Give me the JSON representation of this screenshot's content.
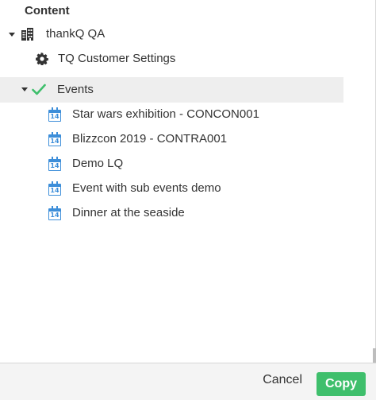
{
  "header": {
    "title": "Content"
  },
  "tree": {
    "root": {
      "label": "thankQ QA",
      "icon": "building-icon",
      "expanded": true
    },
    "settings": {
      "label": "TQ Customer Settings",
      "icon": "gear-icon"
    },
    "events": {
      "label": "Events",
      "icon": "checkmark-icon",
      "expanded": true,
      "selected": true,
      "check_color": "#3fbf6c"
    },
    "event_items": [
      {
        "label": "Star wars exhibition - CONCON001",
        "icon": "calendar-icon",
        "icon_text": "14"
      },
      {
        "label": "Blizzcon 2019 - CONTRA001",
        "icon": "calendar-icon",
        "icon_text": "14"
      },
      {
        "label": "Demo LQ",
        "icon": "calendar-icon",
        "icon_text": "14"
      },
      {
        "label": "Event with sub events demo",
        "icon": "calendar-icon",
        "icon_text": "14"
      },
      {
        "label": "Dinner at the seaside",
        "icon": "calendar-icon",
        "icon_text": "14"
      }
    ]
  },
  "footer": {
    "cancel_label": "Cancel",
    "copy_label": "Copy",
    "copy_color": "#3fbf6c"
  },
  "colors": {
    "calendar_blue": "#3d8ed9",
    "selected_row_bg": "#eeeeee",
    "footer_bg": "#f4f4f4"
  }
}
